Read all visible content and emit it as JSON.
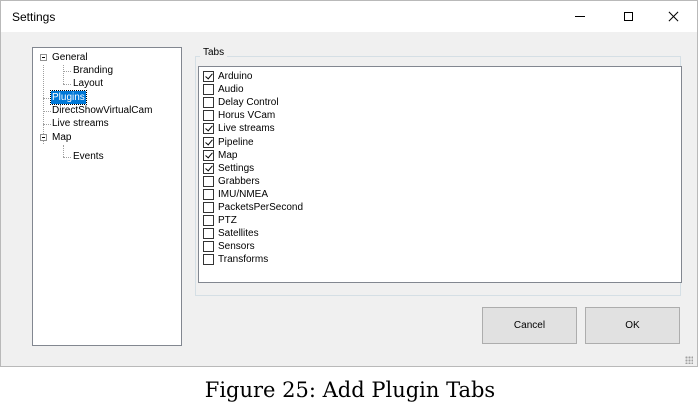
{
  "window": {
    "title": "Settings"
  },
  "tree": {
    "items": [
      {
        "label": "General",
        "expander": "collapse",
        "selected": false
      },
      {
        "label": "Branding",
        "selected": false
      },
      {
        "label": "Layout",
        "selected": false
      },
      {
        "label": "Plugins",
        "selected": true
      },
      {
        "label": "DirectShowVirtualCam",
        "selected": false
      },
      {
        "label": "Live streams",
        "selected": false
      },
      {
        "label": "Map",
        "expander": "collapse",
        "selected": false
      },
      {
        "label": "Events",
        "selected": false
      }
    ]
  },
  "tabs_group": {
    "label": "Tabs",
    "items": [
      {
        "label": "Arduino",
        "checked": true
      },
      {
        "label": "Audio",
        "checked": false
      },
      {
        "label": "Delay Control",
        "checked": false
      },
      {
        "label": "Horus VCam",
        "checked": false
      },
      {
        "label": "Live streams",
        "checked": true
      },
      {
        "label": "Pipeline",
        "checked": true
      },
      {
        "label": "Map",
        "checked": true
      },
      {
        "label": "Settings",
        "checked": true
      },
      {
        "label": "Grabbers",
        "checked": false
      },
      {
        "label": "IMU/NMEA",
        "checked": false
      },
      {
        "label": "PacketsPerSecond",
        "checked": false
      },
      {
        "label": "PTZ",
        "checked": false
      },
      {
        "label": "Satellites",
        "checked": false
      },
      {
        "label": "Sensors",
        "checked": false
      },
      {
        "label": "Transforms",
        "checked": false
      }
    ]
  },
  "buttons": {
    "cancel": "Cancel",
    "ok": "OK"
  },
  "caption": "Figure 25: Add Plugin Tabs",
  "colors": {
    "selection": "#0078d7",
    "dialog_bg": "#f0f0f0"
  }
}
